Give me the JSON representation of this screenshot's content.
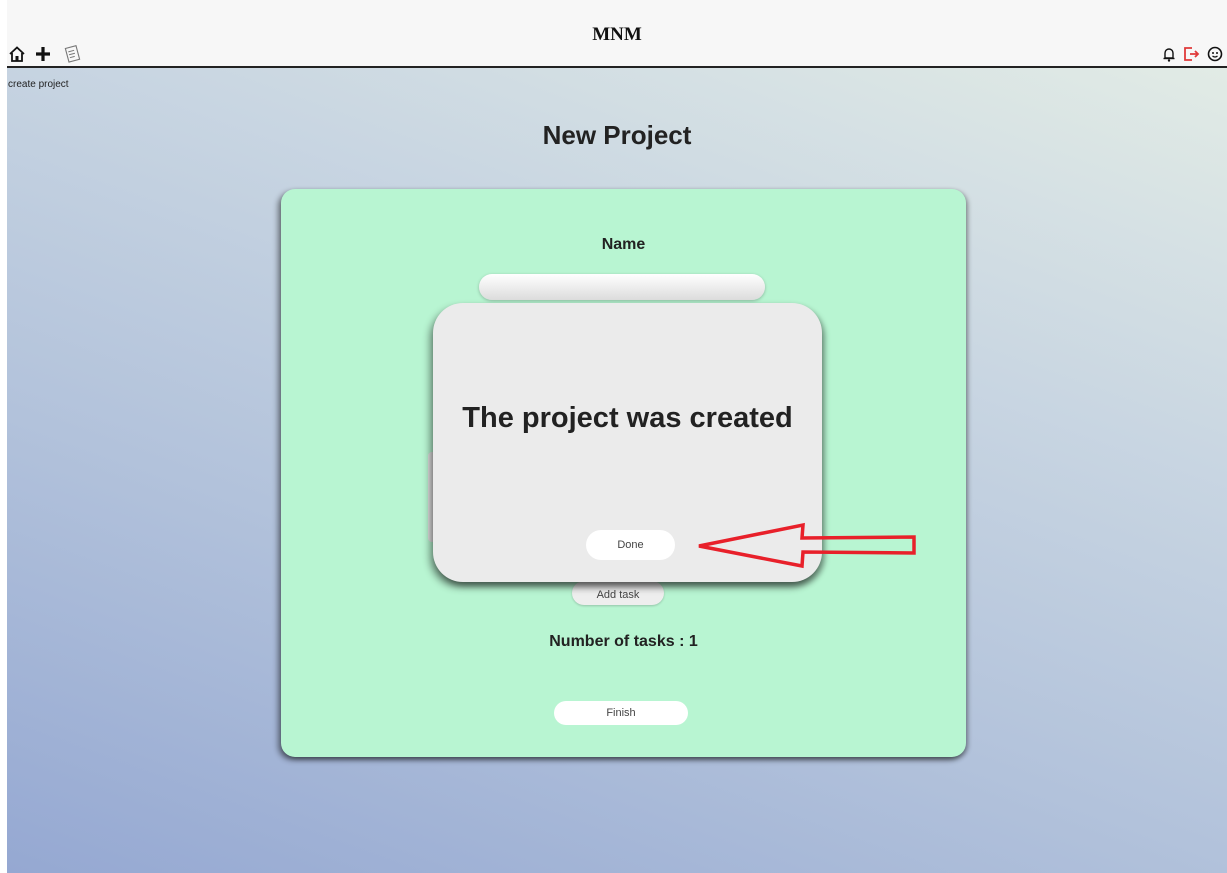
{
  "header": {
    "brand": "MNM",
    "left_icons": [
      "home-icon",
      "plus-icon",
      "notebook-icon"
    ],
    "right_icons": [
      "bell-icon",
      "logout-icon",
      "profile-icon"
    ]
  },
  "breadcrumb": "create project",
  "page_title": "New Project",
  "form": {
    "name_label": "Name",
    "name_value": "",
    "add_task_label": "Add task",
    "tasks_count_text": "Number of tasks : 1",
    "finish_label": "Finish"
  },
  "modal": {
    "message": "The project was created",
    "done_label": "Done"
  },
  "annotation": {
    "arrow_color": "#e8202a"
  },
  "colors": {
    "card_bg": "#b8f5d2",
    "modal_bg": "#ebebeb",
    "logout_icon": "#e03a3a"
  }
}
